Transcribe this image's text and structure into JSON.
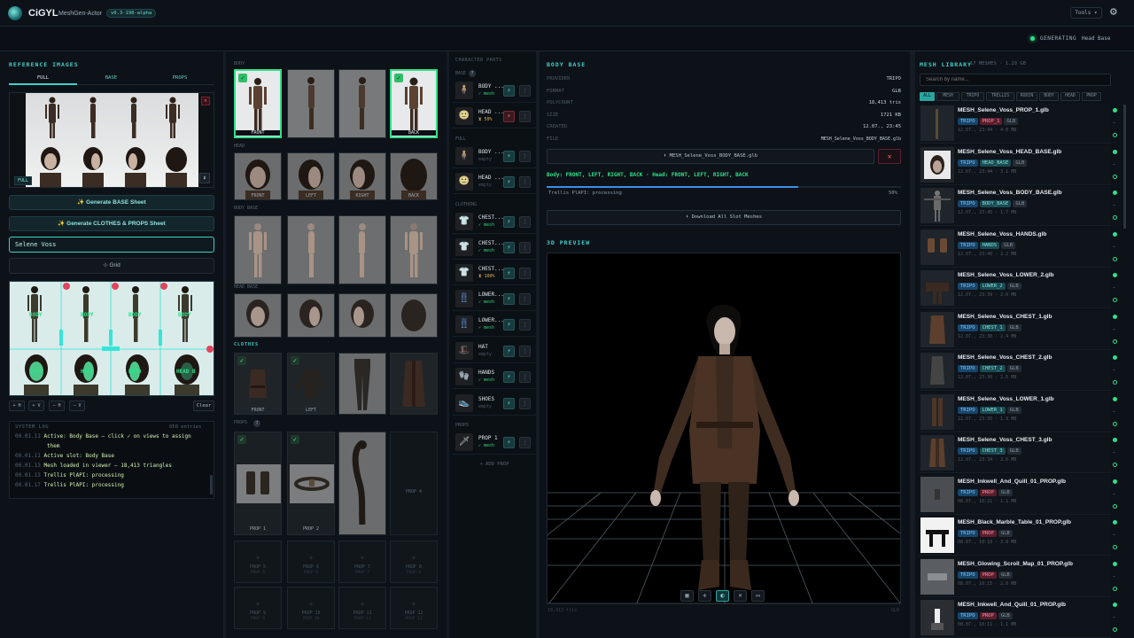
{
  "app": {
    "logo_text": "CiGYL",
    "subtitle": "MeshGen-Actor",
    "version": "v0.3-198-alpha",
    "tools_label": "Tools ▾"
  },
  "status": {
    "label": "GENERATING",
    "target": "Head Base"
  },
  "reference": {
    "title": "REFERENCE IMAGES",
    "tabs": [
      "FULL",
      "BASE",
      "PROPS"
    ],
    "full_badge": "FULL",
    "generate_base": "✨ Generate BASE Sheet",
    "generate_clothes": "✨ Generate CLOTHES & PROPS Sheet",
    "name_value": "Selene Voss",
    "grid_button": "⊹ Grid",
    "grid_labels": [
      "BODY",
      "BODY",
      "BODY",
      "BODY",
      "HEAD",
      "HEAD",
      "HEAD",
      "HEAD B"
    ],
    "nudge_buttons": [
      "+ H",
      "+ V",
      "− H",
      "− V"
    ],
    "clear_label": "Clear"
  },
  "log": {
    "title": "SYSTEM LOG",
    "count": "650 entries",
    "entries": [
      {
        "time": "00.01.11",
        "text": "Active: Body Base — click ✓ on views to assign"
      },
      {
        "time": "",
        "text": "them"
      },
      {
        "time": "00.01.11",
        "text": "Active slot: Body Base"
      },
      {
        "time": "00.01.13",
        "text": "Mesh loaded in viewer — 18,413 triangles"
      },
      {
        "time": "00.01.13",
        "text": "Trellis PlAPI: processing"
      },
      {
        "time": "00.01.17",
        "text": "Trellis PlAPI: processing"
      }
    ]
  },
  "views": {
    "section_body": "BODY",
    "section_head": "HEAD",
    "section_body_base": "BODY BASE",
    "section_head_base": "HEAD BASE",
    "section_clothes": "CLOTHES",
    "section_props": "PROPS",
    "body_labels": [
      "FRONT",
      "",
      "",
      "BACK"
    ],
    "head_labels": [
      "FRONT",
      "LEFT",
      "RIGHT",
      "BACK"
    ],
    "clothes_labels": [
      "FRONT",
      "LEFT",
      "",
      ""
    ],
    "prop_labels": [
      "PROP 1",
      "PROP 2",
      "",
      "PROP 4"
    ],
    "empty_props": [
      {
        "label": "PROP 5",
        "sub": "PROP 5"
      },
      {
        "label": "PROP 6",
        "sub": "PROP 6"
      },
      {
        "label": "PROP 7",
        "sub": "PROP 7"
      },
      {
        "label": "PROP 8",
        "sub": "PROP 8"
      },
      {
        "label": "PROP 9",
        "sub": "PROP 9"
      },
      {
        "label": "PROP 10",
        "sub": "PROP 10"
      },
      {
        "label": "PROP 11",
        "sub": "PROP 11"
      },
      {
        "label": "PROP 12",
        "sub": "PROP 12"
      }
    ]
  },
  "parts": {
    "title": "CHARACTER PARTS",
    "groups": {
      "base": "BASE",
      "full": "FULL",
      "clothing": "CLOTHING",
      "props": "PROPS"
    },
    "slots": [
      {
        "name": "BODY ...",
        "status": "✓ mesh"
      },
      {
        "name": "HEAD ...",
        "status": "⧗ 50%"
      },
      {
        "name": "BODY ...",
        "status": "empty"
      },
      {
        "name": "HEAD ...",
        "status": "empty"
      },
      {
        "name": "CHEST...",
        "status": "✓ mesh"
      },
      {
        "name": "CHEST...",
        "status": "✓ mesh"
      },
      {
        "name": "CHEST...",
        "status": "⧗ 100%"
      },
      {
        "name": "LOWER...",
        "status": "✓ mesh"
      },
      {
        "name": "LOWER...",
        "status": "✓ mesh"
      },
      {
        "name": "HAT",
        "status": "empty"
      },
      {
        "name": "HANDS",
        "status": "✓ mesh"
      },
      {
        "name": "SHOES",
        "status": "empty"
      },
      {
        "name": "PROP 1",
        "status": "✓ mesh"
      }
    ],
    "add_prop": "+ ADD PROP"
  },
  "detail": {
    "title": "BODY BASE",
    "rows": [
      {
        "k": "PROVIDER",
        "v": "TRIPO"
      },
      {
        "k": "FORMAT",
        "v": "GLB"
      },
      {
        "k": "POLYCOUNT",
        "v": "18,413 tris"
      },
      {
        "k": "SIZE",
        "v": "1721 KB"
      },
      {
        "k": "CREATED",
        "v": "12.07., 23:45"
      },
      {
        "k": "FILE",
        "v": "MESH_Selene_Voss_BODY_BASE.glb"
      }
    ],
    "download_file": "⬇ MESH_Selene_Voss_BODY_BASE.glb",
    "delete_icon": "✕",
    "views_line": "Body: FRONT, LEFT, RIGHT, BACK · Head: FRONT, LEFT, RIGHT, BACK",
    "progress": 0.5,
    "progress_text": "Trellis PlAPI: processing",
    "progress_pct": "50%",
    "download_all": "⬇ Download All Slot Meshes"
  },
  "preview": {
    "title": "3D PREVIEW",
    "footer_left": "18,413 tris",
    "footer_right": "GLB"
  },
  "library": {
    "title": "MESH LIBRARY",
    "count": "17 MESHES · 1.20 GB",
    "search_placeholder": "Search by name...",
    "filters": [
      "ALL",
      "MESH",
      "TRIPO",
      "TRELLIS",
      "RODIN",
      "BODY",
      "HEAD",
      "PROP"
    ],
    "items": [
      {
        "name": "MESH_Selene_Voss_PROP_1.glb",
        "tag": "PROP_1",
        "tag_kind": "prop",
        "meta": "12.07., 23:44 · 4.0 MB"
      },
      {
        "name": "MESH_Selene_Voss_HEAD_BASE.glb",
        "tag": "HEAD_BASE",
        "tag_kind": "cat",
        "meta": "12.07., 23:44 · 3.1 MB"
      },
      {
        "name": "MESH_Selene_Voss_BODY_BASE.glb",
        "tag": "BODY_BASE",
        "tag_kind": "cat",
        "meta": "12.07., 23:45 · 1.7 MB"
      },
      {
        "name": "MESH_Selene_Voss_HANDS.glb",
        "tag": "HANDS",
        "tag_kind": "cat",
        "meta": "12.07., 23:40 · 2.2 MB"
      },
      {
        "name": "MESH_Selene_Voss_LOWER_2.glb",
        "tag": "LOWER_2",
        "tag_kind": "cat",
        "meta": "12.07., 23:39 · 2.0 MB"
      },
      {
        "name": "MESH_Selene_Voss_CHEST_1.glb",
        "tag": "CHEST_1",
        "tag_kind": "cat",
        "meta": "12.07., 23:38 · 2.4 MB"
      },
      {
        "name": "MESH_Selene_Voss_CHEST_2.glb",
        "tag": "CHEST_2",
        "tag_kind": "cat",
        "meta": "12.07., 23:36 · 2.5 MB"
      },
      {
        "name": "MESH_Selene_Voss_LOWER_1.glb",
        "tag": "LOWER_1",
        "tag_kind": "cat",
        "meta": "12.07., 23:35 · 1.9 MB"
      },
      {
        "name": "MESH_Selene_Voss_CHEST_3.glb",
        "tag": "CHEST_3",
        "tag_kind": "cat",
        "meta": "12.07., 23:34 · 2.6 MB"
      },
      {
        "name": "MESH_Inkwell_And_Quill_01_PROP.glb",
        "tag": "PROP",
        "tag_kind": "prop",
        "meta": "08.07., 10:21 · 1.1 MB"
      },
      {
        "name": "MESH_Black_Marble_Table_01_PROP.glb",
        "tag": "PROP",
        "tag_kind": "prop",
        "meta": "08.07., 10:18 · 3.8 MB"
      },
      {
        "name": "MESH_Glowing_Scroll_Map_01_PROP.glb",
        "tag": "PROP",
        "tag_kind": "prop",
        "meta": "08.07., 10:15 · 2.0 MB"
      },
      {
        "name": "MESH_Inkwell_And_Quill_01_PROP.glb",
        "tag": "PROP",
        "tag_kind": "prop",
        "meta": "08.07., 10:11 · 1.1 MB"
      }
    ],
    "tripo_tag": "TRIPO",
    "glb_tag": "GLB"
  },
  "colors": {
    "accent": "#3fd0c9",
    "success": "#2fe08a",
    "danger": "#e0455d"
  }
}
